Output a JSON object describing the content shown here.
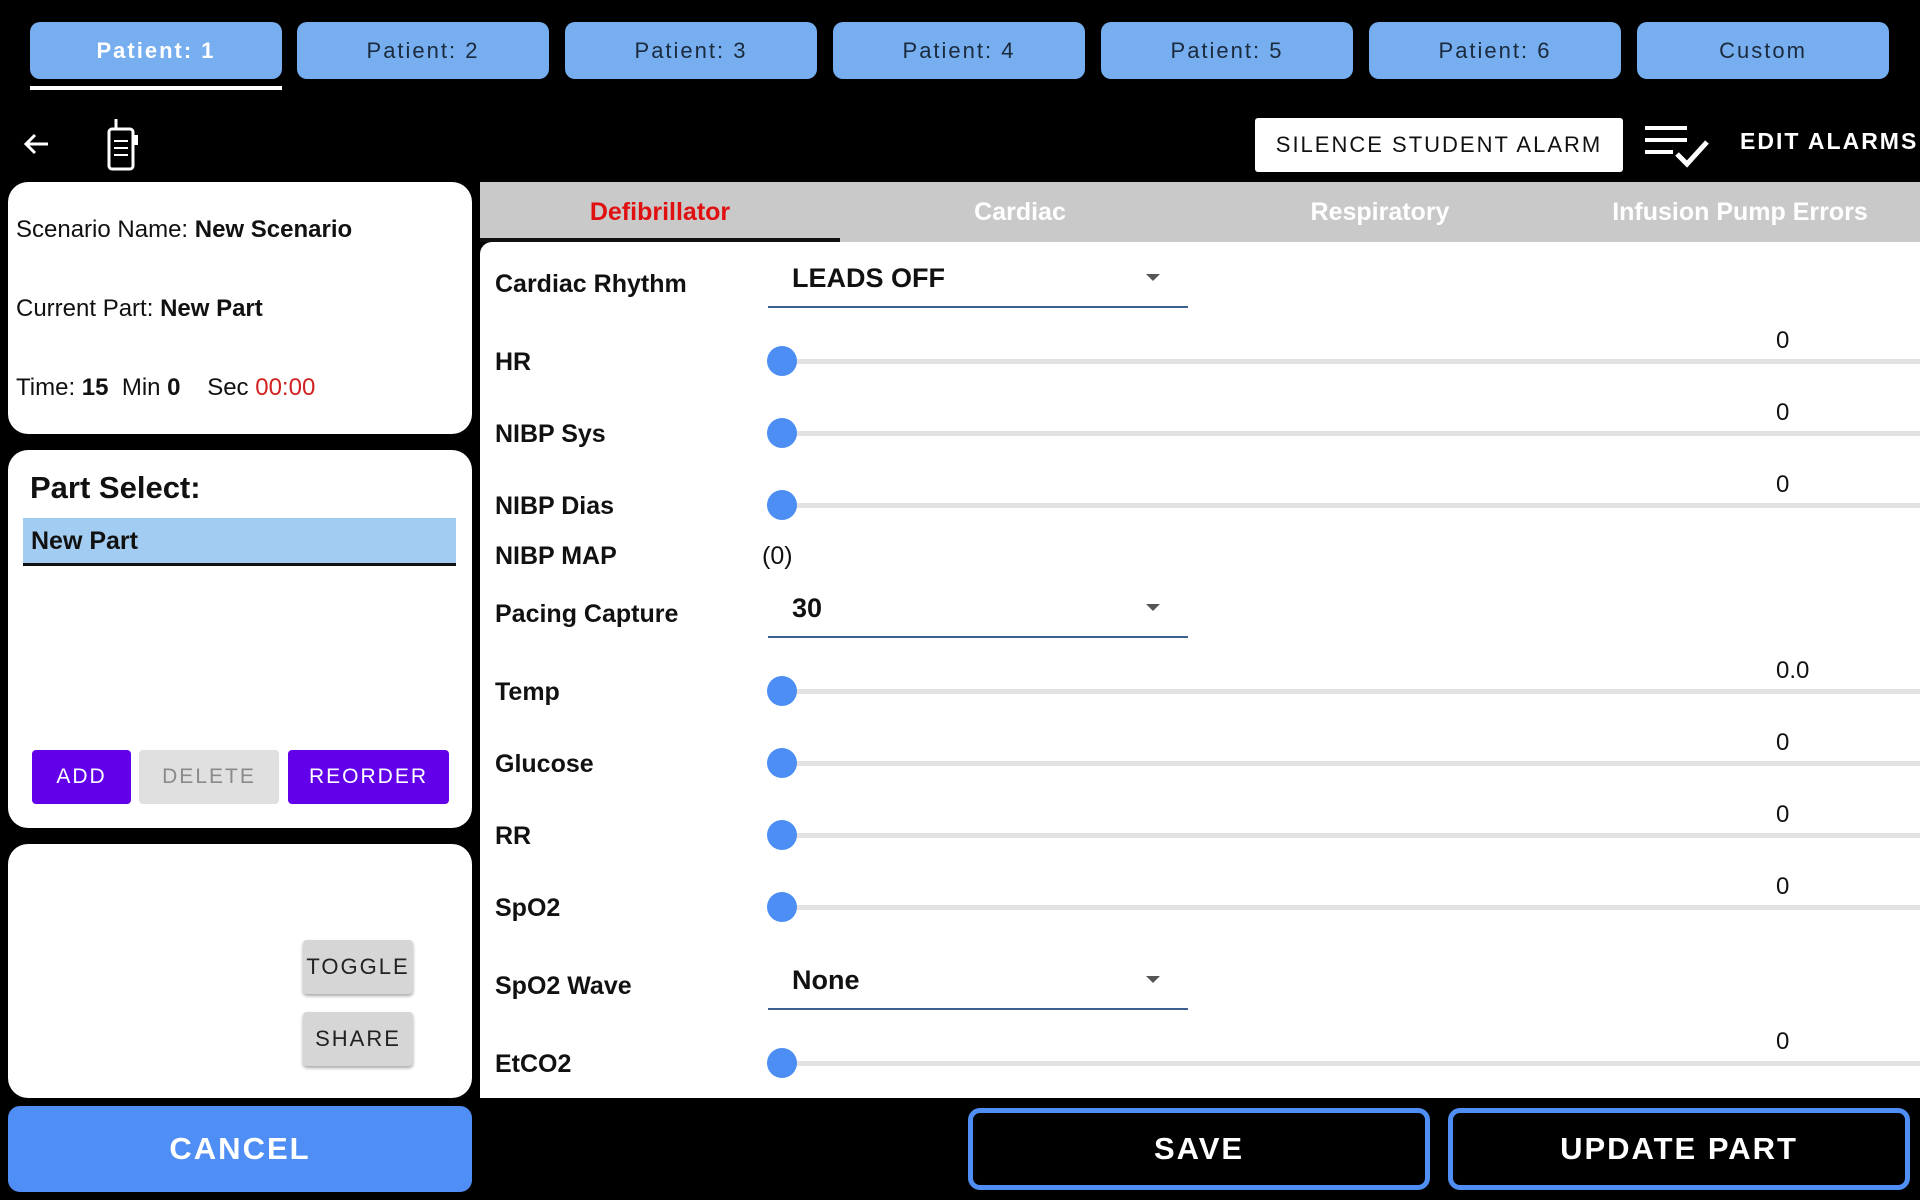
{
  "patient_tabs": [
    "Patient: 1",
    "Patient: 2",
    "Patient: 3",
    "Patient: 4",
    "Patient: 5",
    "Patient: 6",
    "Custom"
  ],
  "active_patient_tab": 0,
  "toolbar": {
    "silence_label": "SILENCE STUDENT ALARM",
    "edit_alarms_label": "EDIT ALARMS"
  },
  "scenario": {
    "name_label": "Scenario Name:",
    "name_value": "New Scenario",
    "part_label": "Current Part:",
    "part_value": "New Part",
    "time_label": "Time:",
    "time_min_value": "15",
    "min_label": "Min",
    "min_value": "0",
    "sec_label": "Sec",
    "elapsed": "00:00"
  },
  "part_select": {
    "title": "Part Select:",
    "items": [
      "New Part"
    ],
    "add_label": "ADD",
    "delete_label": "DELETE",
    "reorder_label": "REORDER"
  },
  "misc_buttons": {
    "toggle_label": "TOGGLE",
    "share_label": "SHARE"
  },
  "bottom": {
    "cancel_label": "CANCEL",
    "save_label": "SAVE",
    "update_label": "UPDATE PART"
  },
  "section_tabs": [
    "Defibrillator",
    "Cardiac",
    "Respiratory",
    "Infusion Pump Errors"
  ],
  "active_section_tab": 0,
  "fields": {
    "cardiac_rhythm": {
      "label": "Cardiac Rhythm",
      "value": "LEADS OFF"
    },
    "hr": {
      "label": "HR",
      "value": "0",
      "fraction": 0
    },
    "nibp_sys": {
      "label": "NIBP Sys",
      "value": "0",
      "fraction": 0
    },
    "nibp_dias": {
      "label": "NIBP Dias",
      "value": "0",
      "fraction": 0
    },
    "nibp_map": {
      "label": "NIBP MAP",
      "value": "(0)"
    },
    "pacing_capture": {
      "label": "Pacing Capture",
      "value": "30"
    },
    "temp": {
      "label": "Temp",
      "value": "0.0",
      "fraction": 0
    },
    "glucose": {
      "label": "Glucose",
      "value": "0",
      "fraction": 0
    },
    "rr": {
      "label": "RR",
      "value": "0",
      "fraction": 0
    },
    "spo2": {
      "label": "SpO2",
      "value": "0",
      "fraction": 0
    },
    "spo2_wave": {
      "label": "SpO2 Wave",
      "value": "None"
    },
    "etco2": {
      "label": "EtCO2",
      "value": "0",
      "fraction": 0
    }
  },
  "colors": {
    "tab_blue": "#76aef0",
    "accent_blue": "#4f8ef5",
    "purple": "#6200ea",
    "active_red": "#e01010"
  },
  "icons": [
    "back-arrow-icon",
    "radio-icon",
    "checklist-icon"
  ]
}
